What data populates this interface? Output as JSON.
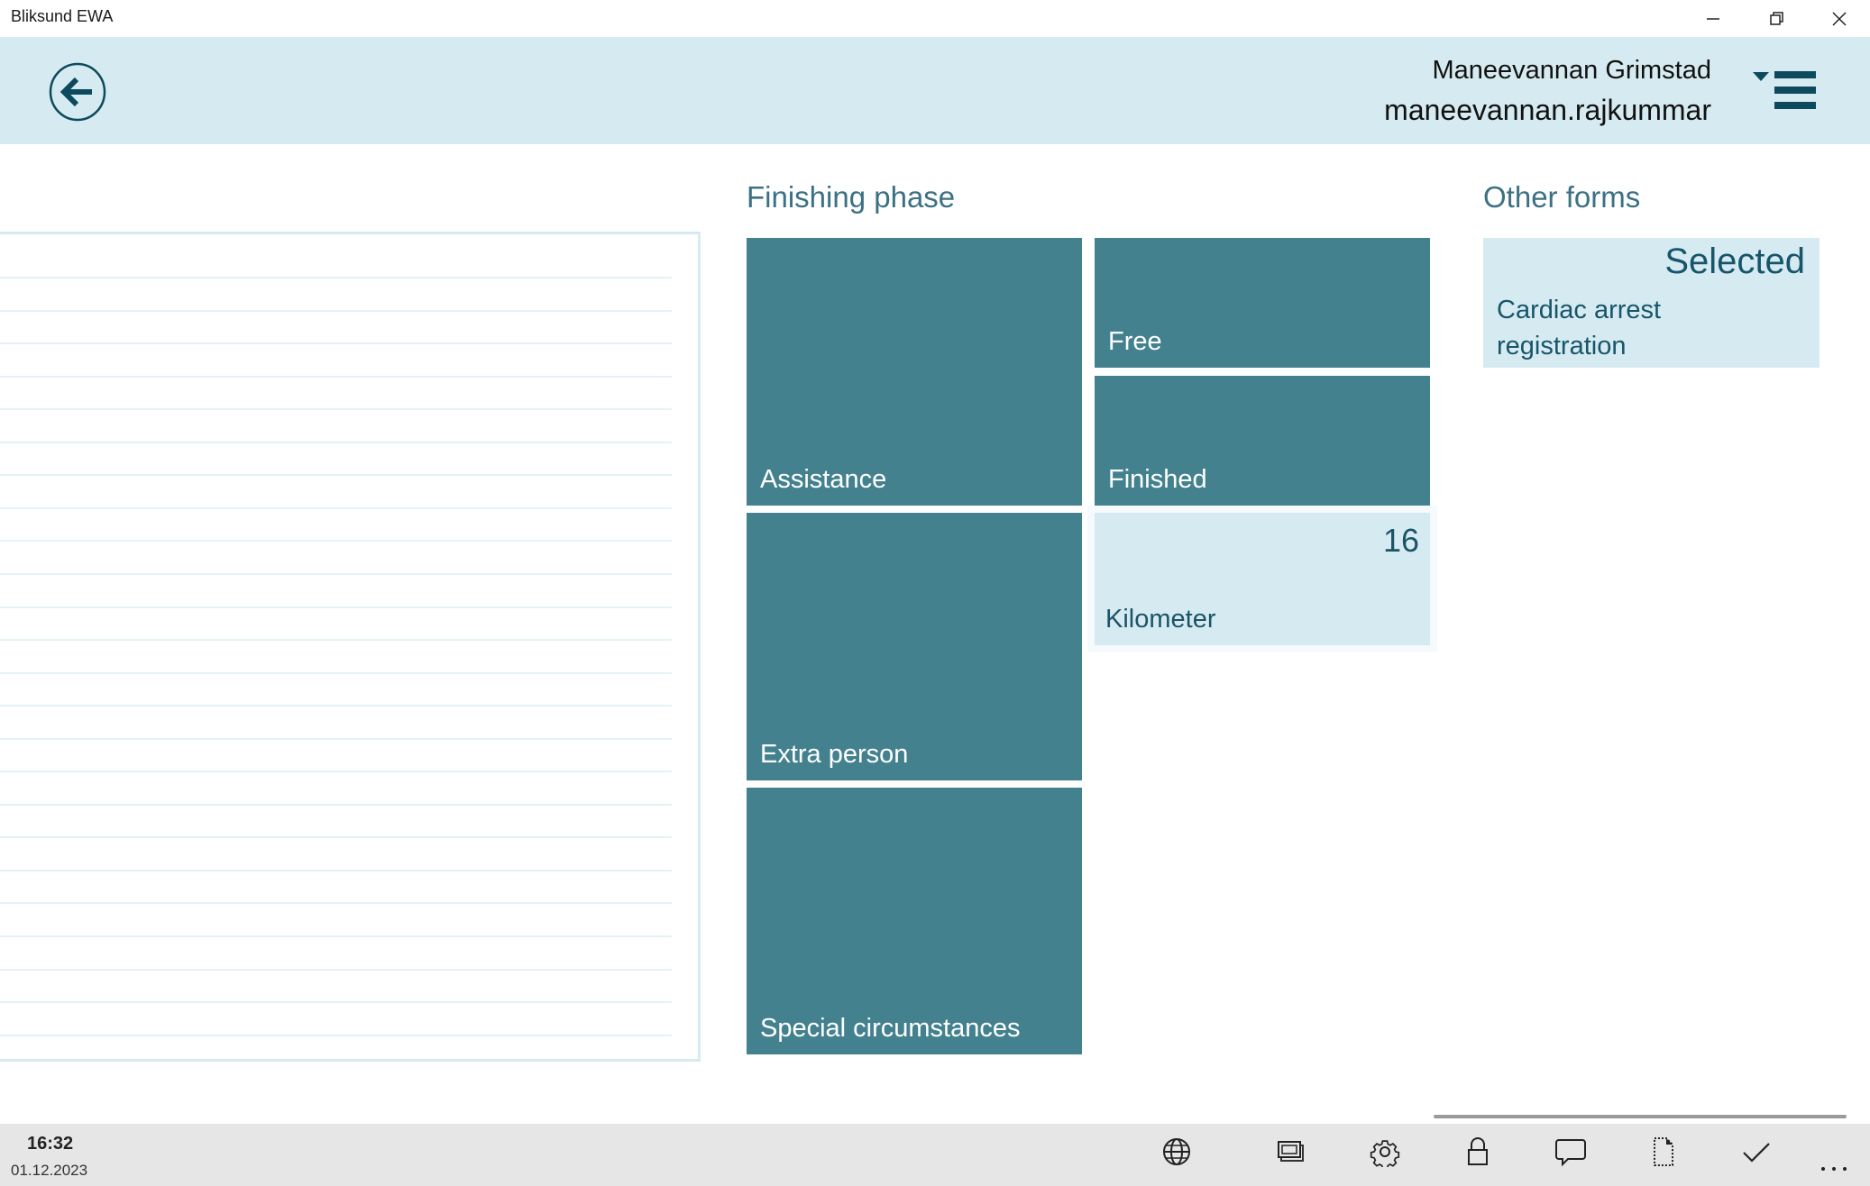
{
  "window": {
    "title": "Bliksund EWA",
    "controls": [
      "minimize",
      "restore",
      "close"
    ]
  },
  "header": {
    "back_icon": "back-arrow-circle-icon",
    "user_fullname": "Maneevannan Grimstad",
    "user_login": "maneevannan.rajkummar",
    "menu_icon": "hamburger-menu-with-dropdown-icon"
  },
  "left_panel": {
    "row_count": 24,
    "rows": [
      "",
      "",
      "",
      "",
      "",
      "",
      "",
      "",
      "",
      "",
      "",
      "",
      "",
      "",
      "",
      "",
      "",
      "",
      "",
      "",
      "",
      "",
      "",
      ""
    ]
  },
  "finishing_phase": {
    "title": "Finishing phase",
    "tiles": [
      {
        "label": "Assistance"
      },
      {
        "label": "Free"
      },
      {
        "label": "Finished"
      },
      {
        "label": "Extra person"
      },
      {
        "label": "Kilometer",
        "value": "16"
      },
      {
        "label": "Special circumstances"
      }
    ]
  },
  "other_forms": {
    "title": "Other forms",
    "tiles": [
      {
        "status": "Selected",
        "label": "Cardiac arrest registration"
      }
    ]
  },
  "footer": {
    "time": "16:32",
    "date": "01.12.2023",
    "icons": [
      "globe-icon",
      "screens-icon",
      "gear-icon",
      "lock-icon",
      "chat-bubble-icon",
      "document-icon",
      "checkmark-icon",
      "more-icon"
    ]
  },
  "colors": {
    "header_bg": "#d6ebf1",
    "tile_dark": "#44818f",
    "tile_light": "#d6ebf1",
    "accent_text": "#1c5467",
    "footer_bg": "#e6e6e6"
  }
}
